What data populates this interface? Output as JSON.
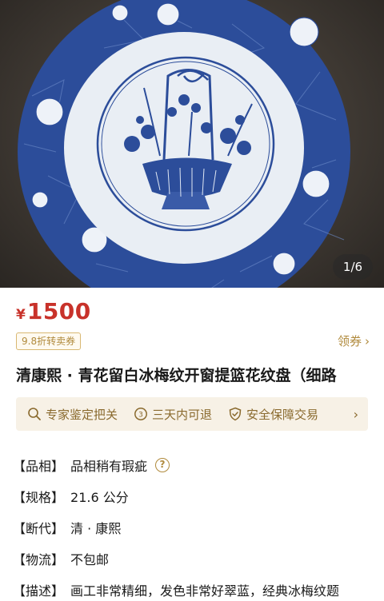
{
  "gallery": {
    "page_indicator": "1/6"
  },
  "price": {
    "currency": "¥",
    "amount": "1500"
  },
  "discount_tag": "9.8折转卖券",
  "coupon_label": "领券",
  "title": "清康熙 · 青花留白冰梅纹开窗提篮花纹盘（细路",
  "guarantees": [
    {
      "icon": "search-icon",
      "label": "专家鉴定把关"
    },
    {
      "icon": "return-icon",
      "label": "三天内可退"
    },
    {
      "icon": "shield-icon",
      "label": "安全保障交易"
    }
  ],
  "attributes": [
    {
      "key": "【品相】",
      "value": "品相稍有瑕疵"
    },
    {
      "key": "【规格】",
      "value": "21.6 公分"
    },
    {
      "key": "【断代】",
      "value": "清 · 康熙"
    },
    {
      "key": "【物流】",
      "value": "不包邮"
    },
    {
      "key": "【描述】",
      "value": "画工非常精细，发色非常好翠蓝，经典冰梅纹题"
    }
  ],
  "colors": {
    "price": "#c8322a",
    "accent_gold": "#b08a3c",
    "guarantee_bg": "#f7f1e6"
  }
}
